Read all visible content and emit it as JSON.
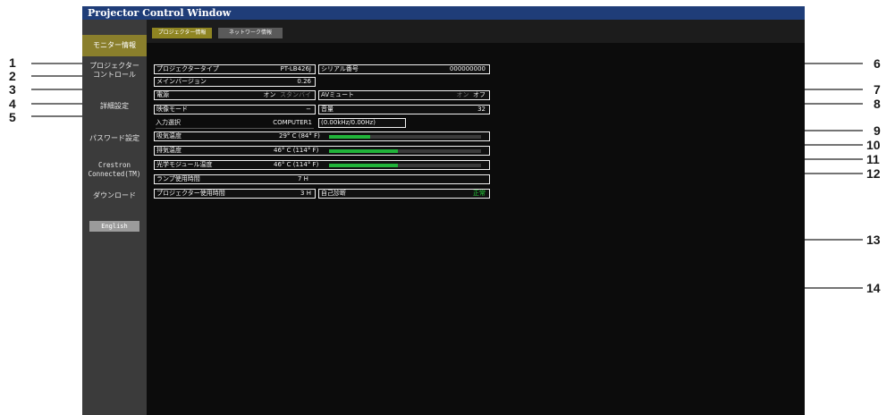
{
  "window": {
    "title": "Projector Control Window"
  },
  "sidebar": {
    "items": [
      {
        "label": "モニター情報",
        "active": true
      },
      {
        "label": "プロジェクター\nコントロール",
        "active": false
      },
      {
        "label": "詳細設定",
        "active": false
      },
      {
        "label": "パスワード設定",
        "active": false
      },
      {
        "label": "Crestron\nConnected(TM)",
        "active": false
      },
      {
        "label": "ダウンロード",
        "active": false
      }
    ],
    "language_button": "English"
  },
  "tabs": [
    {
      "label": "プロジェクター情報",
      "active": true
    },
    {
      "label": "ネットワーク情報",
      "active": false
    }
  ],
  "info": {
    "projector_type": {
      "label": "プロジェクタータイプ",
      "value": "PT-LB426J"
    },
    "main_version": {
      "label": "メインバージョン",
      "value": "0.26"
    },
    "power": {
      "label": "電源",
      "on": "オン",
      "standby": "スタンバイ"
    },
    "picture_mode": {
      "label": "映像モード",
      "value": "−"
    },
    "input": {
      "label": "入力選択",
      "value": "COMPUTER1",
      "signal": "(0.00kHz/0.00Hz)"
    },
    "intake_temp": {
      "label": "吸気温度",
      "value": "29° C (84° F)",
      "level": 0.27
    },
    "exhaust_temp": {
      "label": "排気温度",
      "value": "46° C (114° F)",
      "level": 0.45
    },
    "optical_temp": {
      "label": "光学モジュール温度",
      "value": "46° C (114° F)",
      "level": 0.45
    },
    "lamp_hours": {
      "label": "ランプ使用時間",
      "value": "7 H"
    },
    "projector_hours": {
      "label": "プロジェクター使用時間",
      "value": "3 H"
    },
    "serial": {
      "label": "シリアル番号",
      "value": "000000000"
    },
    "av_mute": {
      "label": "AVミュート",
      "on": "オン",
      "off": "オフ"
    },
    "volume": {
      "label": "音量",
      "value": "32"
    },
    "self_test": {
      "label": "自己診断",
      "value": "正常"
    }
  },
  "callouts": [
    "1",
    "2",
    "3",
    "4",
    "5",
    "6",
    "7",
    "8",
    "9",
    "10",
    "11",
    "12",
    "13",
    "14"
  ],
  "colors": {
    "titlebar": "#1f3d78",
    "active_tab": "#8f8522",
    "bar_fill": "#21b43a",
    "ok_text": "#25d33a"
  }
}
